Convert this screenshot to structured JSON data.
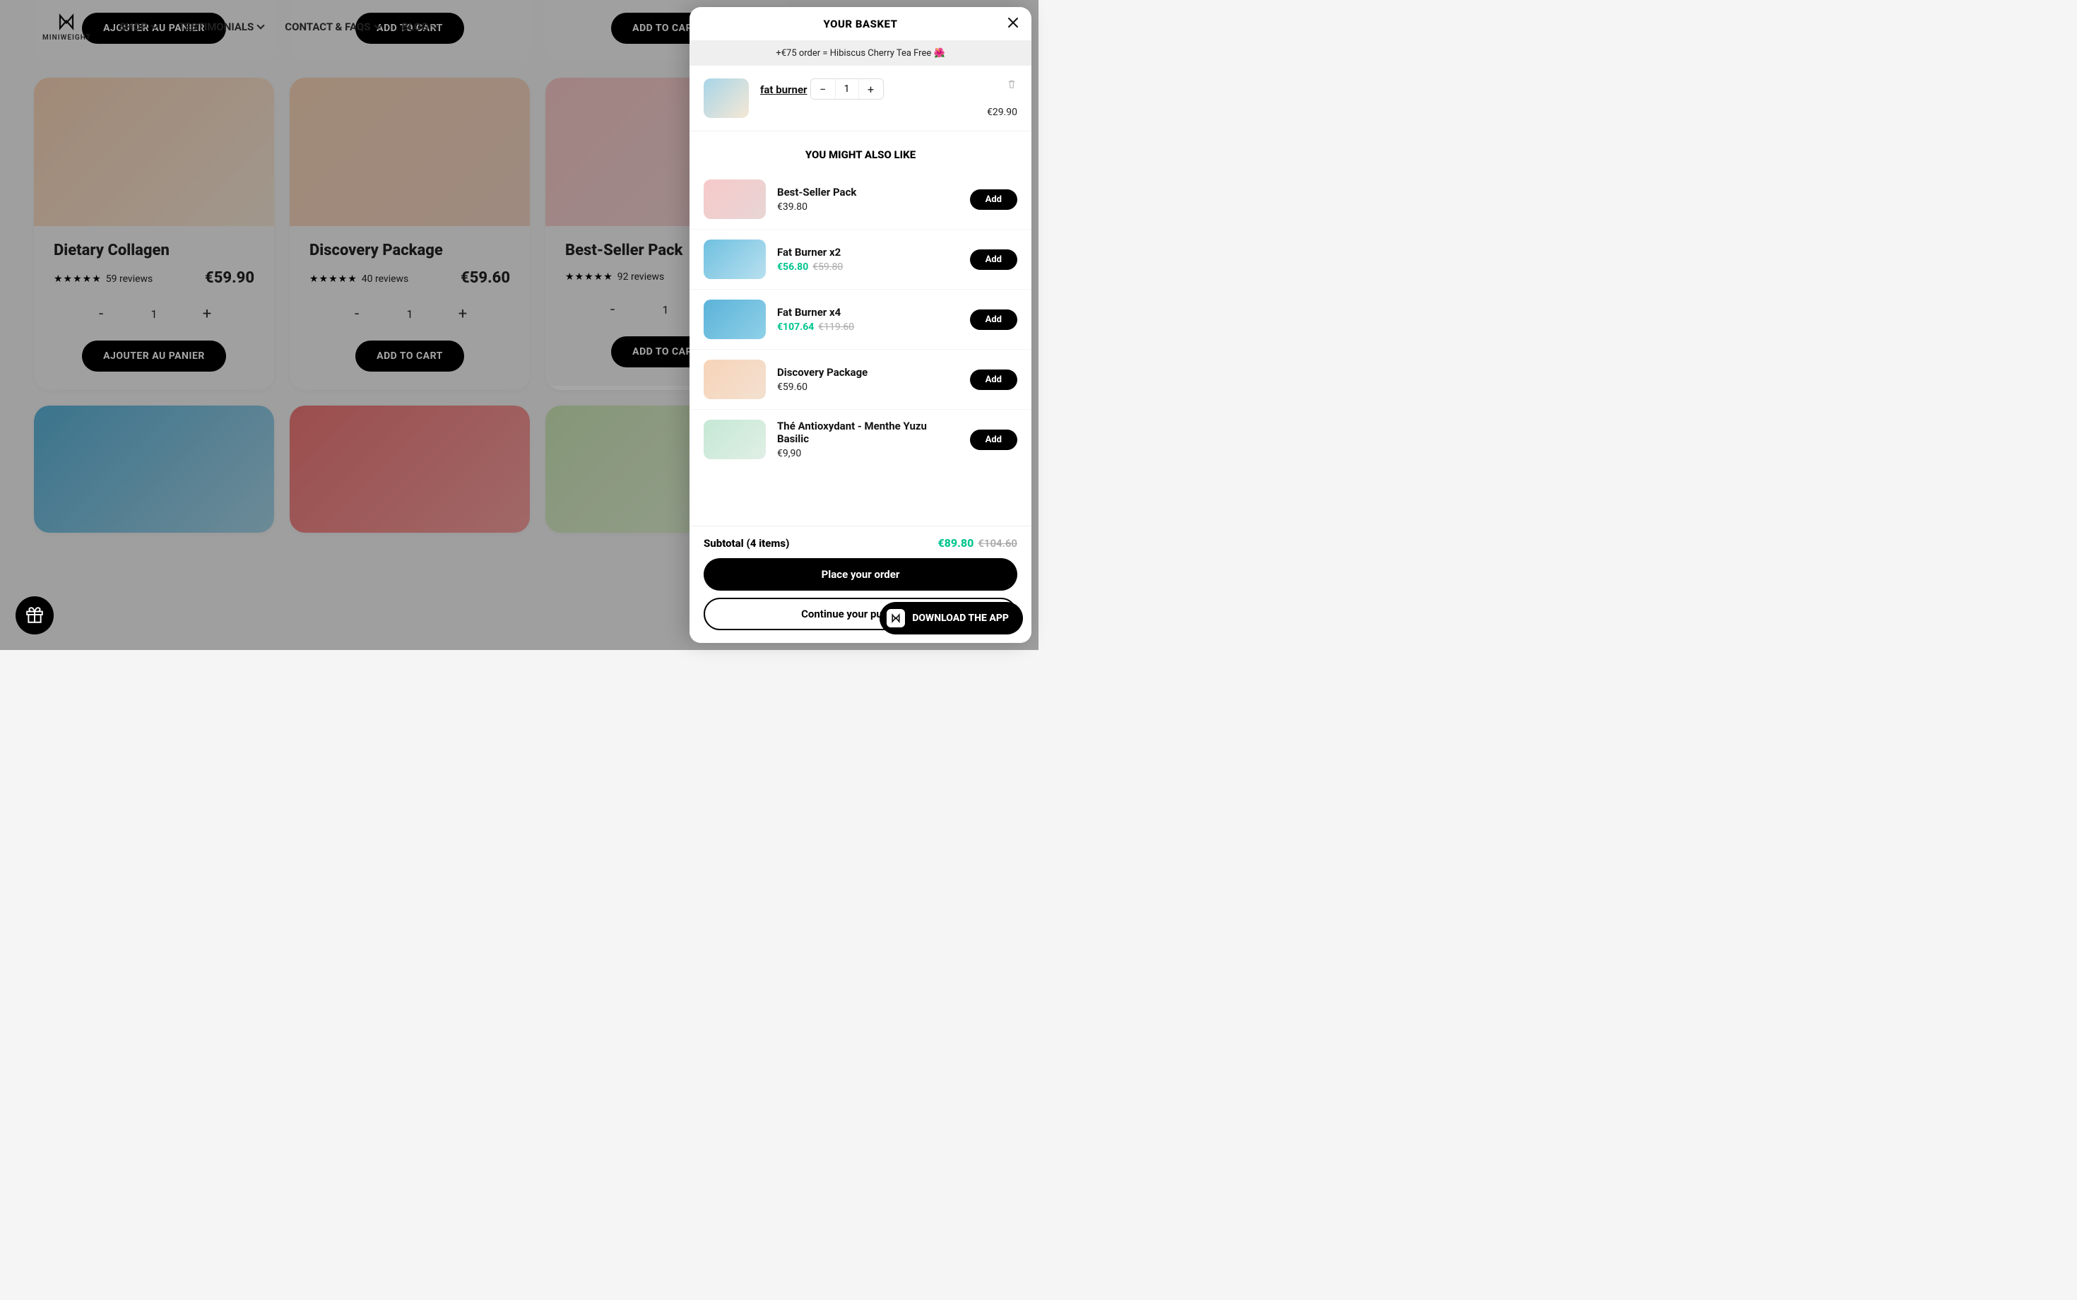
{
  "logo_text": "MINIWEIGHT",
  "nav": [
    "SHOP",
    "TESTIMONIALS",
    "CONTACT & FAQS",
    "BLOG"
  ],
  "products_partial": [
    {
      "add": "AJOUTER AU PANIER",
      "qty": ""
    },
    {
      "add": "ADD TO CART",
      "qty": ""
    },
    {
      "add": "ADD TO CART",
      "qty": ""
    }
  ],
  "products_mid": [
    {
      "title": "Dietary Collagen",
      "reviews": "59 reviews",
      "stars": "★★★★★",
      "price": "€59.90",
      "qty": "1",
      "add": "AJOUTER AU PANIER"
    },
    {
      "title": "Discovery Package",
      "reviews": "40 reviews",
      "stars": "★★★★★",
      "price": "€59.60",
      "qty": "1",
      "add": "ADD TO CART"
    },
    {
      "title": "Best-Seller Pack",
      "reviews": "92 reviews",
      "stars": "★★★★★",
      "price": "",
      "qty": "1",
      "add": "ADD TO CART"
    }
  ],
  "drawer": {
    "title": "YOUR BASKET",
    "promo": "+€75 order = Hibiscus Cherry Tea Free 🌺",
    "cart_item": {
      "name": "fat burner",
      "qty": "1",
      "price": "€29.90"
    },
    "upsell_title": "YOU MIGHT ALSO LIKE",
    "upsells": [
      {
        "name": "Best-Seller Pack",
        "price": "€39.80"
      },
      {
        "name": "Fat Burner x2",
        "sale": "€56.80",
        "strike": "€59.80"
      },
      {
        "name": "Fat Burner x4",
        "sale": "€107.64",
        "strike": "€119.60"
      },
      {
        "name": "Discovery Package",
        "price": "€59.60"
      },
      {
        "name": "Thé Antioxydant - Menthe Yuzu Basilic",
        "price": "€9,90"
      }
    ],
    "add_label": "Add",
    "subtotal_label": "Subtotal (4 items)",
    "subtotal_sale": "€89.80",
    "subtotal_strike": "€104.60",
    "primary": "Place your order",
    "secondary": "Continue your purchases"
  },
  "app_pill": "DOWNLOAD THE APP"
}
